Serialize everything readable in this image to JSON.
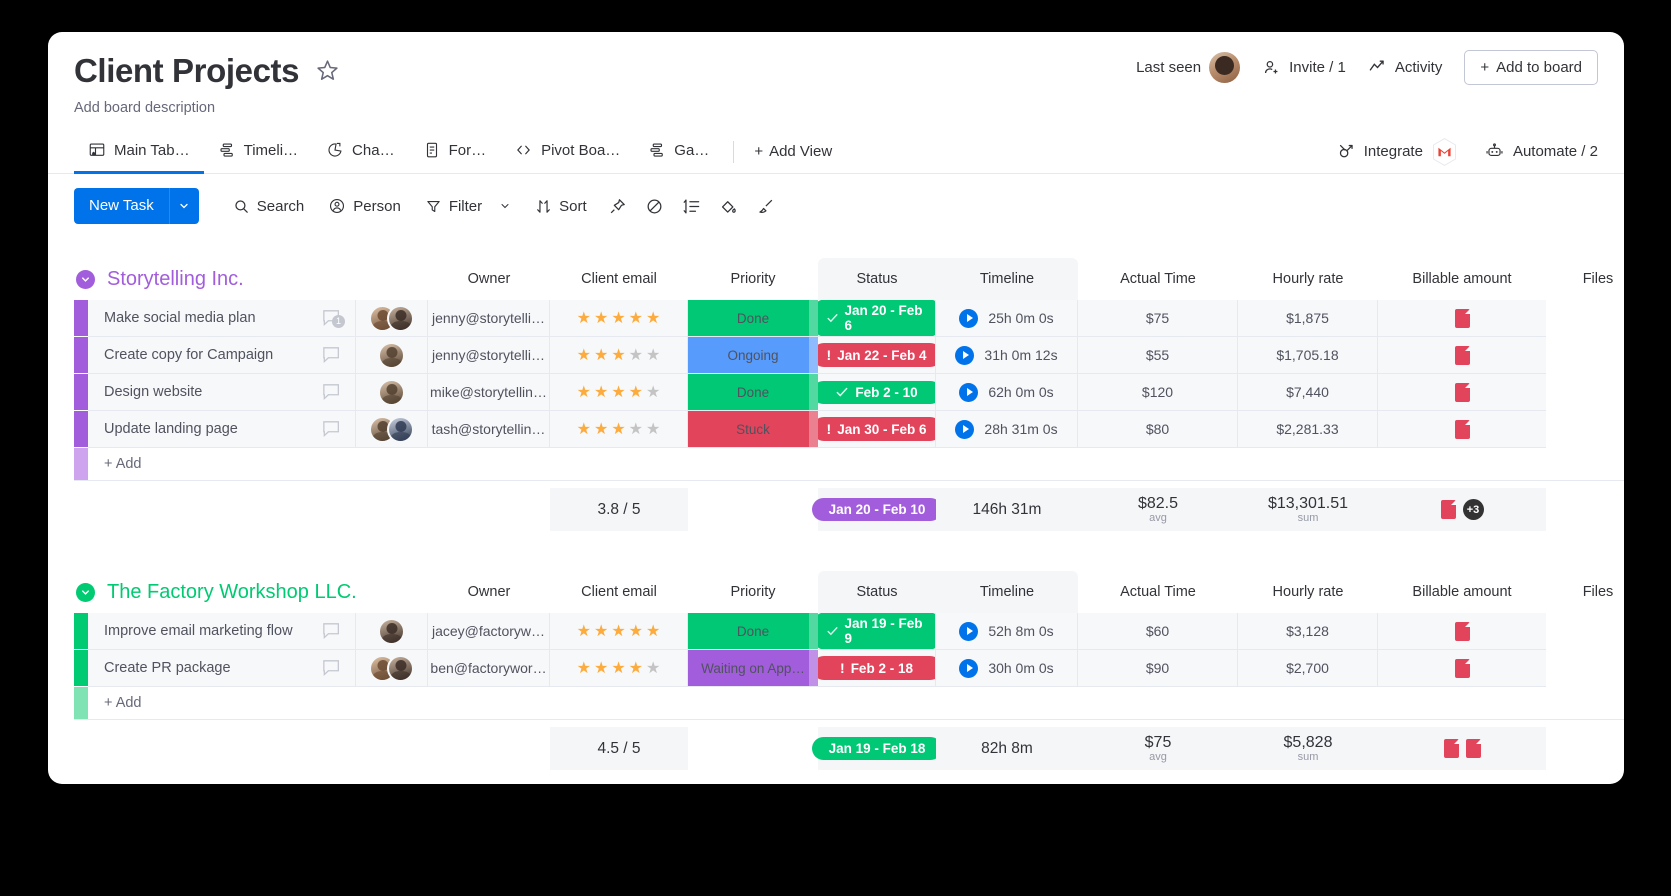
{
  "header": {
    "title": "Client Projects",
    "star_icon": "star-icon",
    "description": "Add board description",
    "last_seen_label": "Last seen",
    "invite_label": "Invite / 1",
    "activity_label": "Activity",
    "add_to_board_label": "Add to board"
  },
  "tabs": [
    {
      "label": "Main Tab…",
      "icon": "table-home-icon",
      "active": true
    },
    {
      "label": "Timeli…",
      "icon": "timeline-icon",
      "active": false
    },
    {
      "label": "Cha…",
      "icon": "chart-pie-icon",
      "active": false
    },
    {
      "label": "For…",
      "icon": "form-icon",
      "active": false
    },
    {
      "label": "Pivot Boa…",
      "icon": "code-brackets-icon",
      "active": false
    },
    {
      "label": "Ga…",
      "icon": "gantt-icon",
      "active": false
    }
  ],
  "add_view_label": "Add View",
  "integrate_label": "Integrate",
  "integrate_badge_icon": "gmail-icon",
  "automate_label": "Automate / 2",
  "toolbar": {
    "new_task_label": "New Task",
    "new_task_caret": "chevron-down-icon",
    "search_label": "Search",
    "person_label": "Person",
    "filter_label": "Filter",
    "filter_caret": "chevron-down-icon",
    "sort_label": "Sort",
    "icons": [
      "pin-icon",
      "hide-eye-icon",
      "row-height-icon",
      "paint-bucket-icon",
      "broom-icon"
    ]
  },
  "columns": [
    "Owner",
    "Client email",
    "Priority",
    "Status",
    "Timeline",
    "Actual Time",
    "Hourly rate",
    "Billable amount",
    "Files"
  ],
  "colors": {
    "accent_blue": "#0073ea",
    "done_green": "#00c875",
    "ongoing_blue": "#579bfc",
    "stuck_red": "#e2445c",
    "waiting_purple": "#a25ddc",
    "star_gold": "#fdab3d",
    "pdf_red": "#e2445c"
  },
  "groups": [
    {
      "name": "Storytelling Inc.",
      "color": "#a25ddc",
      "add_label": "+ Add",
      "rows": [
        {
          "name": "Make social media plan",
          "comment_count": "1",
          "owners": 2,
          "email": "jenny@storytelli…",
          "priority": 5,
          "status": "Done",
          "status_color": "#00c875",
          "timeline": "Jan 20 - Feb 6",
          "timeline_color": "green",
          "timeline_icon": "check-icon",
          "actual_time": "25h 0m 0s",
          "hourly_rate": "$75",
          "billable": "$1,875",
          "files": 1
        },
        {
          "name": "Create copy for Campaign",
          "comment_count": "",
          "owners": 1,
          "email": "jenny@storytelli…",
          "priority": 3,
          "status": "Ongoing",
          "status_color": "#579bfc",
          "timeline": "Jan 22 - Feb 4",
          "timeline_color": "red",
          "timeline_icon": "exclamation-icon",
          "actual_time": "31h 0m 12s",
          "hourly_rate": "$55",
          "billable": "$1,705.18",
          "files": 1
        },
        {
          "name": "Design website",
          "comment_count": "",
          "owners": 1,
          "email": "mike@storytellin…",
          "priority": 4,
          "status": "Done",
          "status_color": "#00c875",
          "timeline": "Feb 2 - 10",
          "timeline_color": "green",
          "timeline_icon": "check-icon",
          "actual_time": "62h 0m 0s",
          "hourly_rate": "$120",
          "billable": "$7,440",
          "files": 1
        },
        {
          "name": "Update landing page",
          "comment_count": "",
          "owners": 2,
          "email": "tash@storytellin…",
          "priority": 3,
          "status": "Stuck",
          "status_color": "#e2445c",
          "timeline": "Jan 30 - Feb 6",
          "timeline_color": "red",
          "timeline_icon": "exclamation-icon",
          "actual_time": "28h 31m 0s",
          "hourly_rate": "$80",
          "billable": "$2,281.33",
          "files": 1
        }
      ],
      "summary": {
        "priority": "3.8 / 5",
        "timeline": "Jan 20 - Feb 10",
        "actual_time": "146h 31m",
        "hourly_rate": "$82.5",
        "hourly_rate_sub": "avg",
        "billable": "$13,301.51",
        "billable_sub": "sum",
        "files_extra": "+3"
      }
    },
    {
      "name": "The Factory Workshop LLC.",
      "color": "#00ca72",
      "add_label": "+ Add",
      "rows": [
        {
          "name": "Improve email marketing flow",
          "comment_count": "",
          "owners": 1,
          "email": "jacey@factoryw…",
          "priority": 5,
          "status": "Done",
          "status_color": "#00c875",
          "timeline": "Jan 19 - Feb 9",
          "timeline_color": "green",
          "timeline_icon": "check-icon",
          "actual_time": "52h 8m 0s",
          "hourly_rate": "$60",
          "billable": "$3,128",
          "files": 1
        },
        {
          "name": "Create PR package",
          "comment_count": "",
          "owners": 2,
          "email": "ben@factorywor…",
          "priority": 4,
          "status": "Waiting on App…",
          "status_color": "#a25ddc",
          "timeline": "Feb 2 - 18",
          "timeline_color": "red",
          "timeline_icon": "exclamation-icon",
          "actual_time": "30h 0m 0s",
          "hourly_rate": "$90",
          "billable": "$2,700",
          "files": 1
        }
      ],
      "summary": {
        "priority": "4.5 / 5",
        "timeline": "Jan 19 - Feb 18",
        "actual_time": "82h 8m",
        "hourly_rate": "$75",
        "hourly_rate_sub": "avg",
        "billable": "$5,828",
        "billable_sub": "sum",
        "files_extra": ""
      }
    }
  ]
}
